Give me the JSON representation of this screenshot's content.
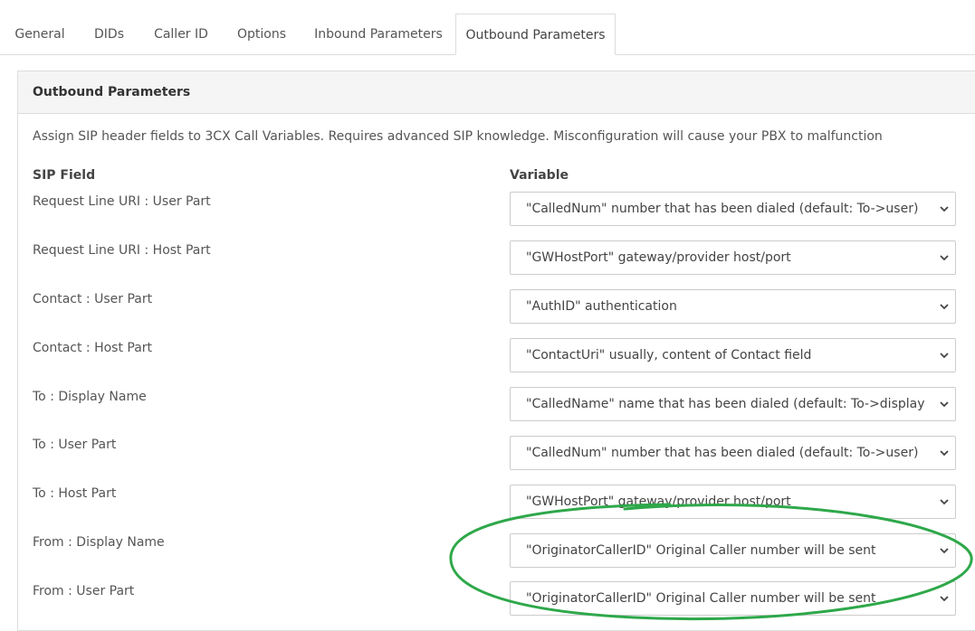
{
  "tabs": [
    {
      "label": "General"
    },
    {
      "label": "DIDs"
    },
    {
      "label": "Caller ID"
    },
    {
      "label": "Options"
    },
    {
      "label": "Inbound Parameters"
    },
    {
      "label": "Outbound Parameters",
      "active": true
    }
  ],
  "panel": {
    "title": "Outbound Parameters",
    "description": "Assign SIP header fields to 3CX Call Variables. Requires advanced SIP knowledge. Misconfiguration will cause your PBX to malfunction",
    "col_sip_field": "SIP Field",
    "col_variable": "Variable"
  },
  "rows": [
    {
      "field": "Request Line URI : User Part",
      "variable": "\"CalledNum\" number that has been dialed (default: To->user)"
    },
    {
      "field": "Request Line URI : Host Part",
      "variable": "\"GWHostPort\" gateway/provider host/port"
    },
    {
      "field": "Contact : User Part",
      "variable": "\"AuthID\" authentication"
    },
    {
      "field": "Contact : Host Part",
      "variable": "\"ContactUri\" usually, content of Contact field"
    },
    {
      "field": "To : Display Name",
      "variable": "\"CalledName\" name that has been dialed (default: To->display name)"
    },
    {
      "field": "To : User Part",
      "variable": "\"CalledNum\" number that has been dialed (default: To->user)"
    },
    {
      "field": "To : Host Part",
      "variable": "\"GWHostPort\" gateway/provider host/port"
    },
    {
      "field": "From : Display Name",
      "variable": "\"OriginatorCallerID\" Original Caller number will be sent"
    },
    {
      "field": "From : User Part",
      "variable": "\"OriginatorCallerID\" Original Caller number will be sent"
    }
  ],
  "icons": {
    "select_caret": "chevron-down-icon"
  },
  "colors": {
    "annotation_ellipse": "#2ea84a",
    "panel_heading_bg": "#f5f5f5",
    "border": "#dddddd"
  }
}
